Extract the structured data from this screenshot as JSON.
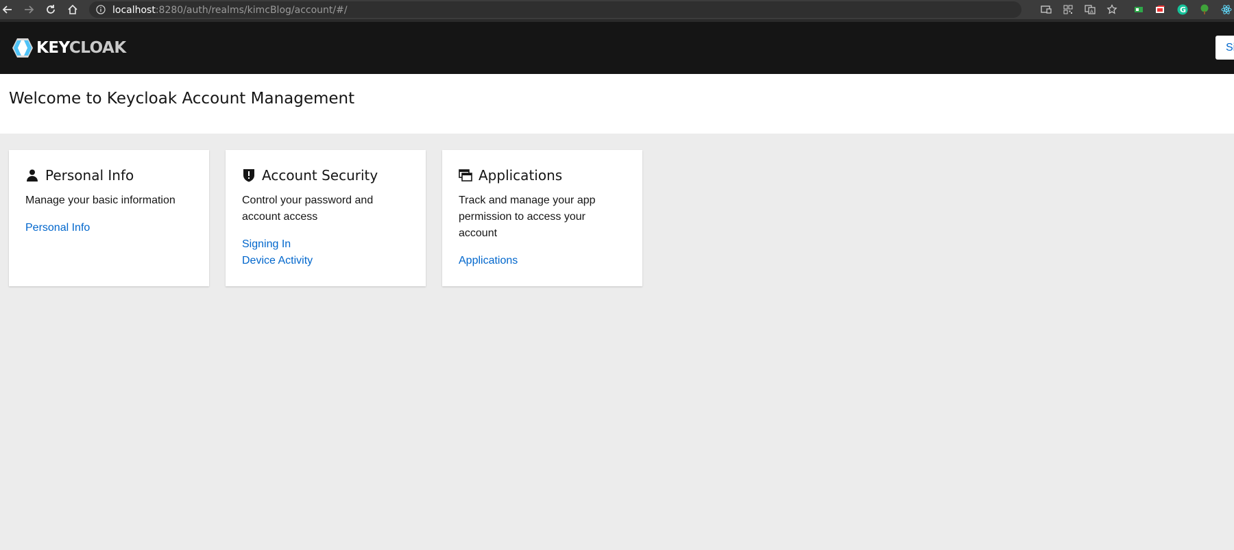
{
  "browser": {
    "url_host": "localhost",
    "url_rest": ":8280/auth/realms/kimcBlog/account/#/"
  },
  "masthead": {
    "logo_key": "KEY",
    "logo_cloak": "CLOAK",
    "signout_label": "Si"
  },
  "page": {
    "title": "Welcome to Keycloak Account Management"
  },
  "cards": [
    {
      "icon": "user-icon",
      "title": "Personal Info",
      "description": "Manage your basic information",
      "links": [
        "Personal Info"
      ]
    },
    {
      "icon": "shield-icon",
      "title": "Account Security",
      "description": "Control your password and account access",
      "links": [
        "Signing In",
        "Device Activity"
      ]
    },
    {
      "icon": "applications-icon",
      "title": "Applications",
      "description": "Track and manage your app permission to access your account",
      "links": [
        "Applications"
      ]
    }
  ],
  "colors": {
    "masthead_bg": "#151515",
    "page_bg": "#ececec",
    "link": "#0066cc",
    "logo_accent": "#4fc3f7"
  }
}
